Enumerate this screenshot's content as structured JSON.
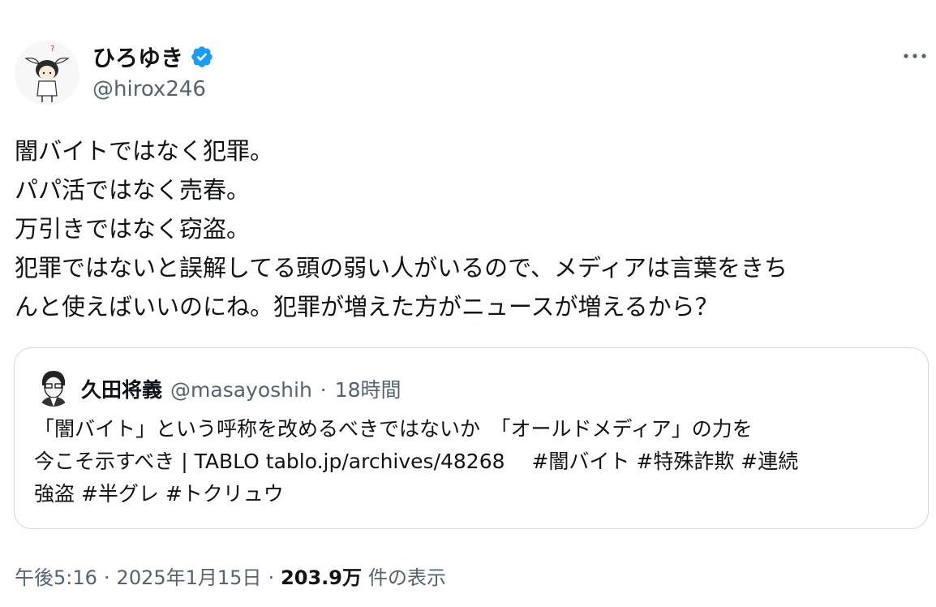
{
  "author": {
    "display_name": "ひろゆき",
    "handle": "@hirox246",
    "avatar_icon": "character-avatar-icon",
    "verified_icon": "verified-badge-icon",
    "verified_color": "#1d9bf0"
  },
  "tweet": {
    "text": "闇バイトではなく犯罪。\nパパ活ではなく売春。\n万引きではなく窃盗。\n犯罪ではないと誤解してる頭の弱い人がいるので、メディアは言葉をきち\nんと使えばいいのにね。犯罪が増えた方がニュースが増えるから？"
  },
  "quote": {
    "name": "久田将義",
    "handle": "@masayoshih",
    "separator": "·",
    "time": "18時間",
    "text": "「闇バイト」という呼称を改めるべきではないか　「オールドメディア」の力を\n今こそ示すべき | TABLO tablo.jp/archives/48268　 #闇バイト #特殊詐欺 #連続\n強盗 #半グレ #トクリュウ"
  },
  "meta": {
    "time": "午後5:16",
    "sep1": "·",
    "date": "2025年1月15日",
    "sep2": "·",
    "views": "203.9万",
    "views_label": "件の表示"
  },
  "colors": {
    "text": "#0f1419",
    "secondary": "#536471",
    "border": "#cfd9de"
  }
}
